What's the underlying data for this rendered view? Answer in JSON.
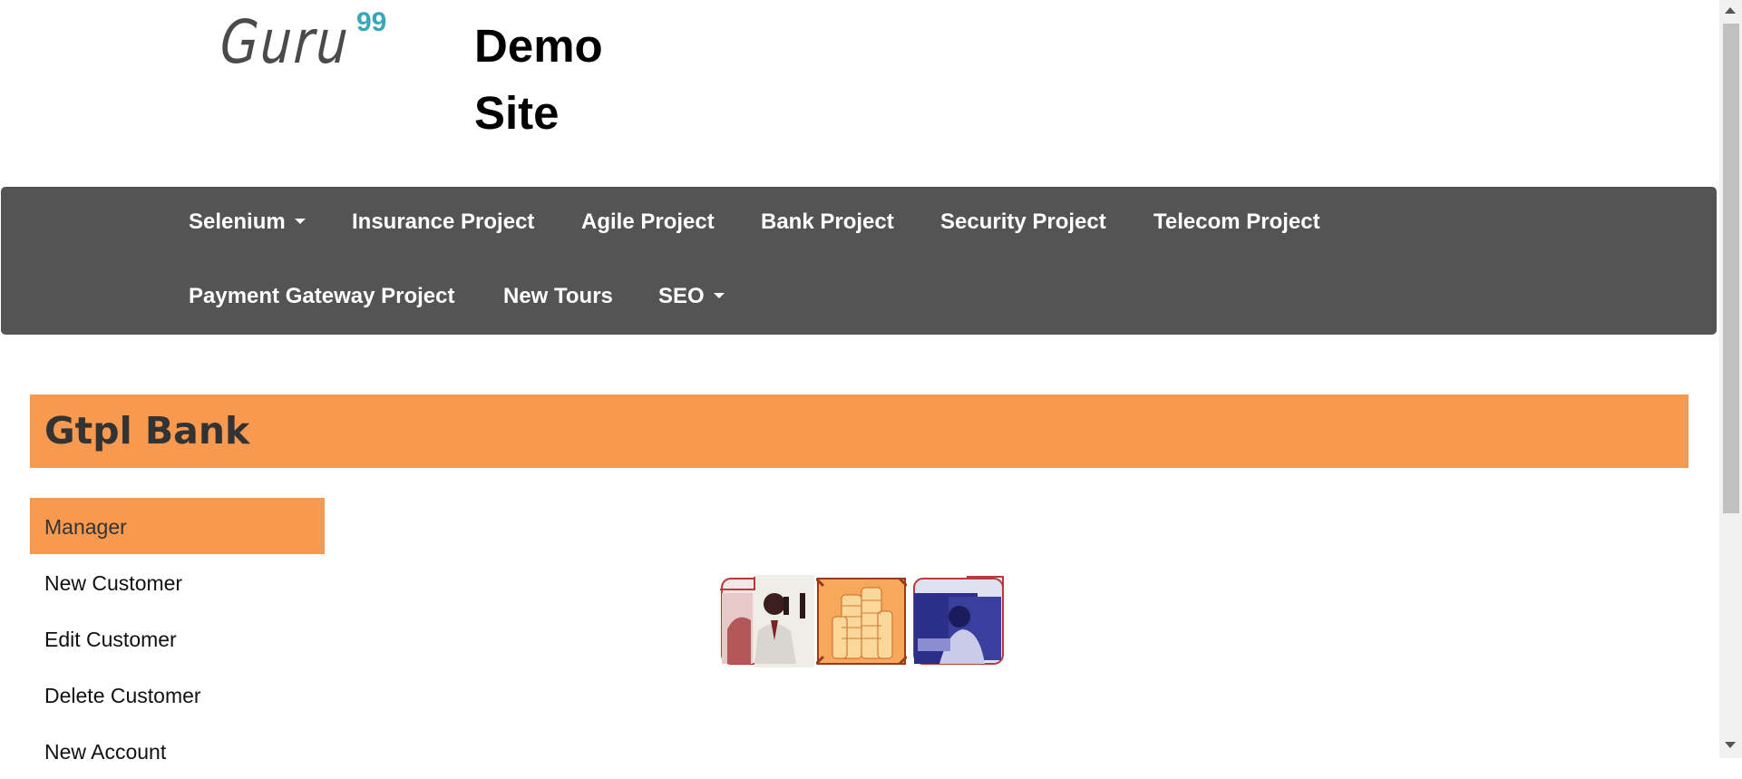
{
  "header": {
    "logo_text": "Guru",
    "logo_sup": "99",
    "site_title": "Demo Site"
  },
  "navbar": {
    "items": [
      {
        "label": "Selenium",
        "dropdown": true
      },
      {
        "label": "Insurance Project",
        "dropdown": false
      },
      {
        "label": "Agile Project",
        "dropdown": false
      },
      {
        "label": "Bank Project",
        "dropdown": false
      },
      {
        "label": "Security Project",
        "dropdown": false
      },
      {
        "label": "Telecom Project",
        "dropdown": false
      },
      {
        "label": "Payment Gateway Project",
        "dropdown": false
      },
      {
        "label": "New Tours",
        "dropdown": false
      },
      {
        "label": "SEO",
        "dropdown": true
      }
    ]
  },
  "bank": {
    "title": "Gtpl Bank"
  },
  "sidebar": {
    "items": [
      {
        "label": "Manager",
        "active": true
      },
      {
        "label": "New Customer",
        "active": false
      },
      {
        "label": "Edit Customer",
        "active": false
      },
      {
        "label": "Delete Customer",
        "active": false
      },
      {
        "label": "New Account",
        "active": false
      }
    ]
  },
  "images": [
    {
      "name": "businessman-phone-image"
    },
    {
      "name": "coin-stacks-image"
    },
    {
      "name": "woman-office-image"
    }
  ],
  "colors": {
    "navbar_bg": "#545454",
    "accent_orange": "#f79a50",
    "logo_teal": "#3aa6b9"
  }
}
